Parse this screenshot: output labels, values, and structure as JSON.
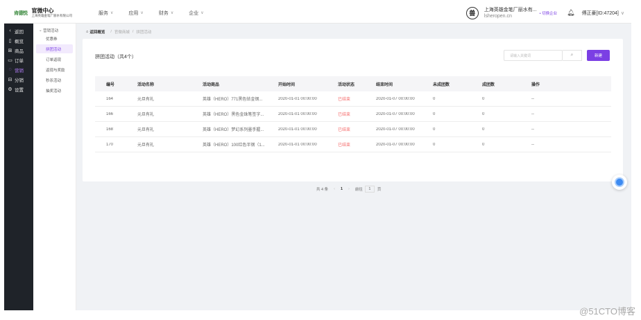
{
  "header": {
    "logo_text": "肯德悦",
    "app_title": "官微中心",
    "company_short": "上海英雄金笔厂丽水有限公司",
    "nav": [
      {
        "label": "服务"
      },
      {
        "label": "应用"
      },
      {
        "label": "财务"
      },
      {
        "label": "企业"
      }
    ],
    "org_seal_char": "兽",
    "org_name": "上海英雄金笔厂丽水有...",
    "org_domain": "lsheropen.cn",
    "switch_label": "• 切换企业",
    "user_name": "傅正豪[ID:47204]"
  },
  "sidebar_dark": {
    "items": [
      {
        "icon": "back-icon",
        "glyph": "‹",
        "label": "返回"
      },
      {
        "icon": "overview-icon",
        "glyph": "▯",
        "label": "概览"
      },
      {
        "icon": "goods-icon",
        "glyph": "⊞",
        "label": "商品"
      },
      {
        "icon": "order-icon",
        "glyph": "▭",
        "label": "订单"
      },
      {
        "icon": "marketing-icon",
        "glyph": "◌",
        "label": "营销"
      },
      {
        "icon": "distribution-icon",
        "glyph": "⊟",
        "label": "分销"
      },
      {
        "icon": "settings-icon",
        "glyph": "⚙",
        "label": "设置"
      }
    ]
  },
  "sidebar_light": {
    "group_title": "营销活动",
    "items": [
      {
        "label": "优惠券"
      },
      {
        "label": "拼团活动"
      },
      {
        "label": "订单返现"
      },
      {
        "label": "返现与奖励"
      },
      {
        "label": "秒杀活动"
      },
      {
        "label": "抽奖活动"
      }
    ]
  },
  "breadcrumb": {
    "home": "返回概览",
    "items": [
      "官微商城",
      "拼团活动"
    ]
  },
  "card": {
    "title": "拼团活动（共4个）",
    "search_placeholder": "请输入关键词",
    "new_button": "新建"
  },
  "table": {
    "headers": [
      "编号",
      "活动名称",
      "活动商品",
      "开始时间",
      "活动状态",
      "结束时间",
      "未成团数",
      "成团数",
      "操作"
    ],
    "rows": [
      {
        "id": "164",
        "name": "元旦有礼",
        "product": "英雄（HERO）771黑色铱金钢...",
        "start": "2020-01-01 00:00:00",
        "status": "已结束",
        "end": "2020-01-07 00:00:00",
        "unformed": "0",
        "formed": "0",
        "action": "--"
      },
      {
        "id": "166",
        "name": "元旦有礼",
        "product": "英雄（HERO）黑色金珠笔签字...",
        "start": "2020-01-01 00:00:00",
        "status": "已结束",
        "end": "2020-01-07 00:00:00",
        "unformed": "0",
        "formed": "0",
        "action": "--"
      },
      {
        "id": "168",
        "name": "元旦有礼",
        "product": "英雄（HERO）梦幻系列墨手握...",
        "start": "2020-01-01 00:00:00",
        "status": "已结束",
        "end": "2020-01-07 00:00:00",
        "unformed": "0",
        "formed": "0",
        "action": "--"
      },
      {
        "id": "170",
        "name": "元旦有礼",
        "product": "英雄（HERO）100红色半钢（1...",
        "start": "2020-01-01 00:00:00",
        "status": "已结束",
        "end": "2020-01-07 00:00:00",
        "unformed": "0",
        "formed": "0",
        "action": "--"
      }
    ]
  },
  "pager": {
    "total": "共 4 条",
    "prev": "‹",
    "current": "1",
    "next": "›",
    "goto_label": "前往",
    "goto_value": "1",
    "page_suffix": "页"
  },
  "watermark": "@51CTO博客",
  "colors": {
    "accent": "#7b3fe4",
    "danger": "#f56c6c",
    "sidebar_dark": "#1f2329"
  }
}
